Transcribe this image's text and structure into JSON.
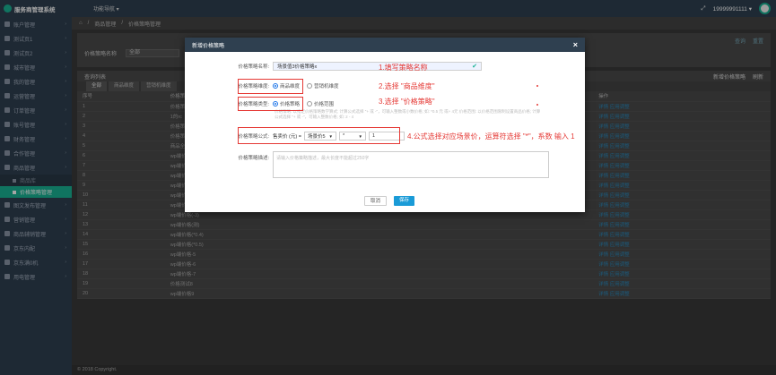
{
  "app": {
    "title": "服务商管理系统",
    "top_nav": "功能导航 ▾",
    "user": "19999991111 ▾"
  },
  "sidebar": [
    {
      "label": "账户管理"
    },
    {
      "label": "测试页1"
    },
    {
      "label": "测试页2"
    },
    {
      "label": "城市管理"
    },
    {
      "label": "我的管理"
    },
    {
      "label": "运营管理"
    },
    {
      "label": "订单管理"
    },
    {
      "label": "账号管理"
    },
    {
      "label": "财务管理"
    },
    {
      "label": "合作管理"
    },
    {
      "label": "商品管理"
    }
  ],
  "sidebar_sub": [
    {
      "label": "商品库"
    },
    {
      "label": "价格策略管理"
    }
  ],
  "sidebar_after": [
    {
      "label": "图文发布管理"
    },
    {
      "label": "营销管理"
    },
    {
      "label": "商品辅销管理"
    },
    {
      "label": "京东内配"
    },
    {
      "label": "京东满0机"
    },
    {
      "label": "用电管理"
    }
  ],
  "breadcrumb": {
    "b1": "商品管理",
    "b2": "价格策略管理"
  },
  "filter": {
    "label": "价格策略名称",
    "select": "全部",
    "search": "查询",
    "reset": "重置"
  },
  "list": {
    "title": "查询列表",
    "add": "新增价格策略",
    "refresh": "刷新"
  },
  "tabs": [
    {
      "label": "全部"
    },
    {
      "label": "商品维度"
    },
    {
      "label": "营销机维度"
    }
  ],
  "table": {
    "headers": [
      "序号",
      "价格策略名称 ⇕",
      "",
      "",
      "",
      "",
      "",
      "操作"
    ],
    "rows": [
      [
        "1",
        "价格策略1"
      ],
      [
        "2",
        "1的rc"
      ],
      [
        "3",
        "价格策略测试"
      ],
      [
        "4",
        "价格策略测试"
      ],
      [
        "5",
        "商品全部减0.1"
      ],
      [
        "6",
        "wp端价格(0.25)"
      ],
      [
        "7",
        "wp端价(+10+20)"
      ],
      [
        "8",
        "wp端价格2"
      ],
      [
        "9",
        "wp端价格0"
      ],
      [
        "10",
        "wp端价格(*0.2)"
      ],
      [
        "11",
        "wp端价格"
      ],
      [
        "12",
        "wp端价格(-3)"
      ],
      [
        "13",
        "wp端价格(测)"
      ],
      [
        "14",
        "wp端价格(*0.4)"
      ],
      [
        "15",
        "wp端价格(*0.5)"
      ],
      [
        "16",
        "wp端价格-5"
      ],
      [
        "17",
        "wp端价格-6"
      ],
      [
        "18",
        "wp端价格-7"
      ],
      [
        "19",
        "价格测试8"
      ],
      [
        "20",
        "wp端价格9"
      ]
    ],
    "op_edit": "详情",
    "op_del": "应用调整"
  },
  "footer": "© 2018 Copyright.",
  "modal": {
    "title": "新增价格策略",
    "name_label": "价格策略名称:",
    "name_value": "场景值3价格策略x",
    "dim_label": "价格策略维度:",
    "dim_opt1": "商品维度",
    "dim_opt2": "营销机维度",
    "type_label": "价格策略类型:",
    "type_opt1": "价格策略",
    "type_opt2": "价格范围",
    "hint": "价格策略: 以指定价格策略数学算式; 计算公式选择 \"+ 或 -\"，可输入整数或小数价格; 如: *0.5 元 或+ 4元 价格范围: 以价格范围限制设置商品价格; 计算公式选择 \"+ 或 -\"，可输入整数价格; 如: 2 - 4",
    "formula_label": "价格策略公式:",
    "formula_prefix": "售卖价 (元) =",
    "formula_sel1": "场景价5",
    "formula_sel2": "*",
    "formula_value": "1",
    "desc_label": "价格策略描述:",
    "desc_placeholder": "请输入价格策略描述，最大长度不能超过250字",
    "cancel": "取消",
    "save": "保存"
  },
  "annotations": {
    "a1": "1.填写策略名称",
    "a2": "2.选择 \"商品维度\"",
    "a3": "3.选择 \"价格策略\"",
    "a4": "4.公式选择对应场景价，运算符选择 \"*\"，系数 输入 1"
  },
  "colors": {
    "accent": "#1ab394",
    "annotation": "#e53935",
    "save": "#1a9bd7"
  }
}
